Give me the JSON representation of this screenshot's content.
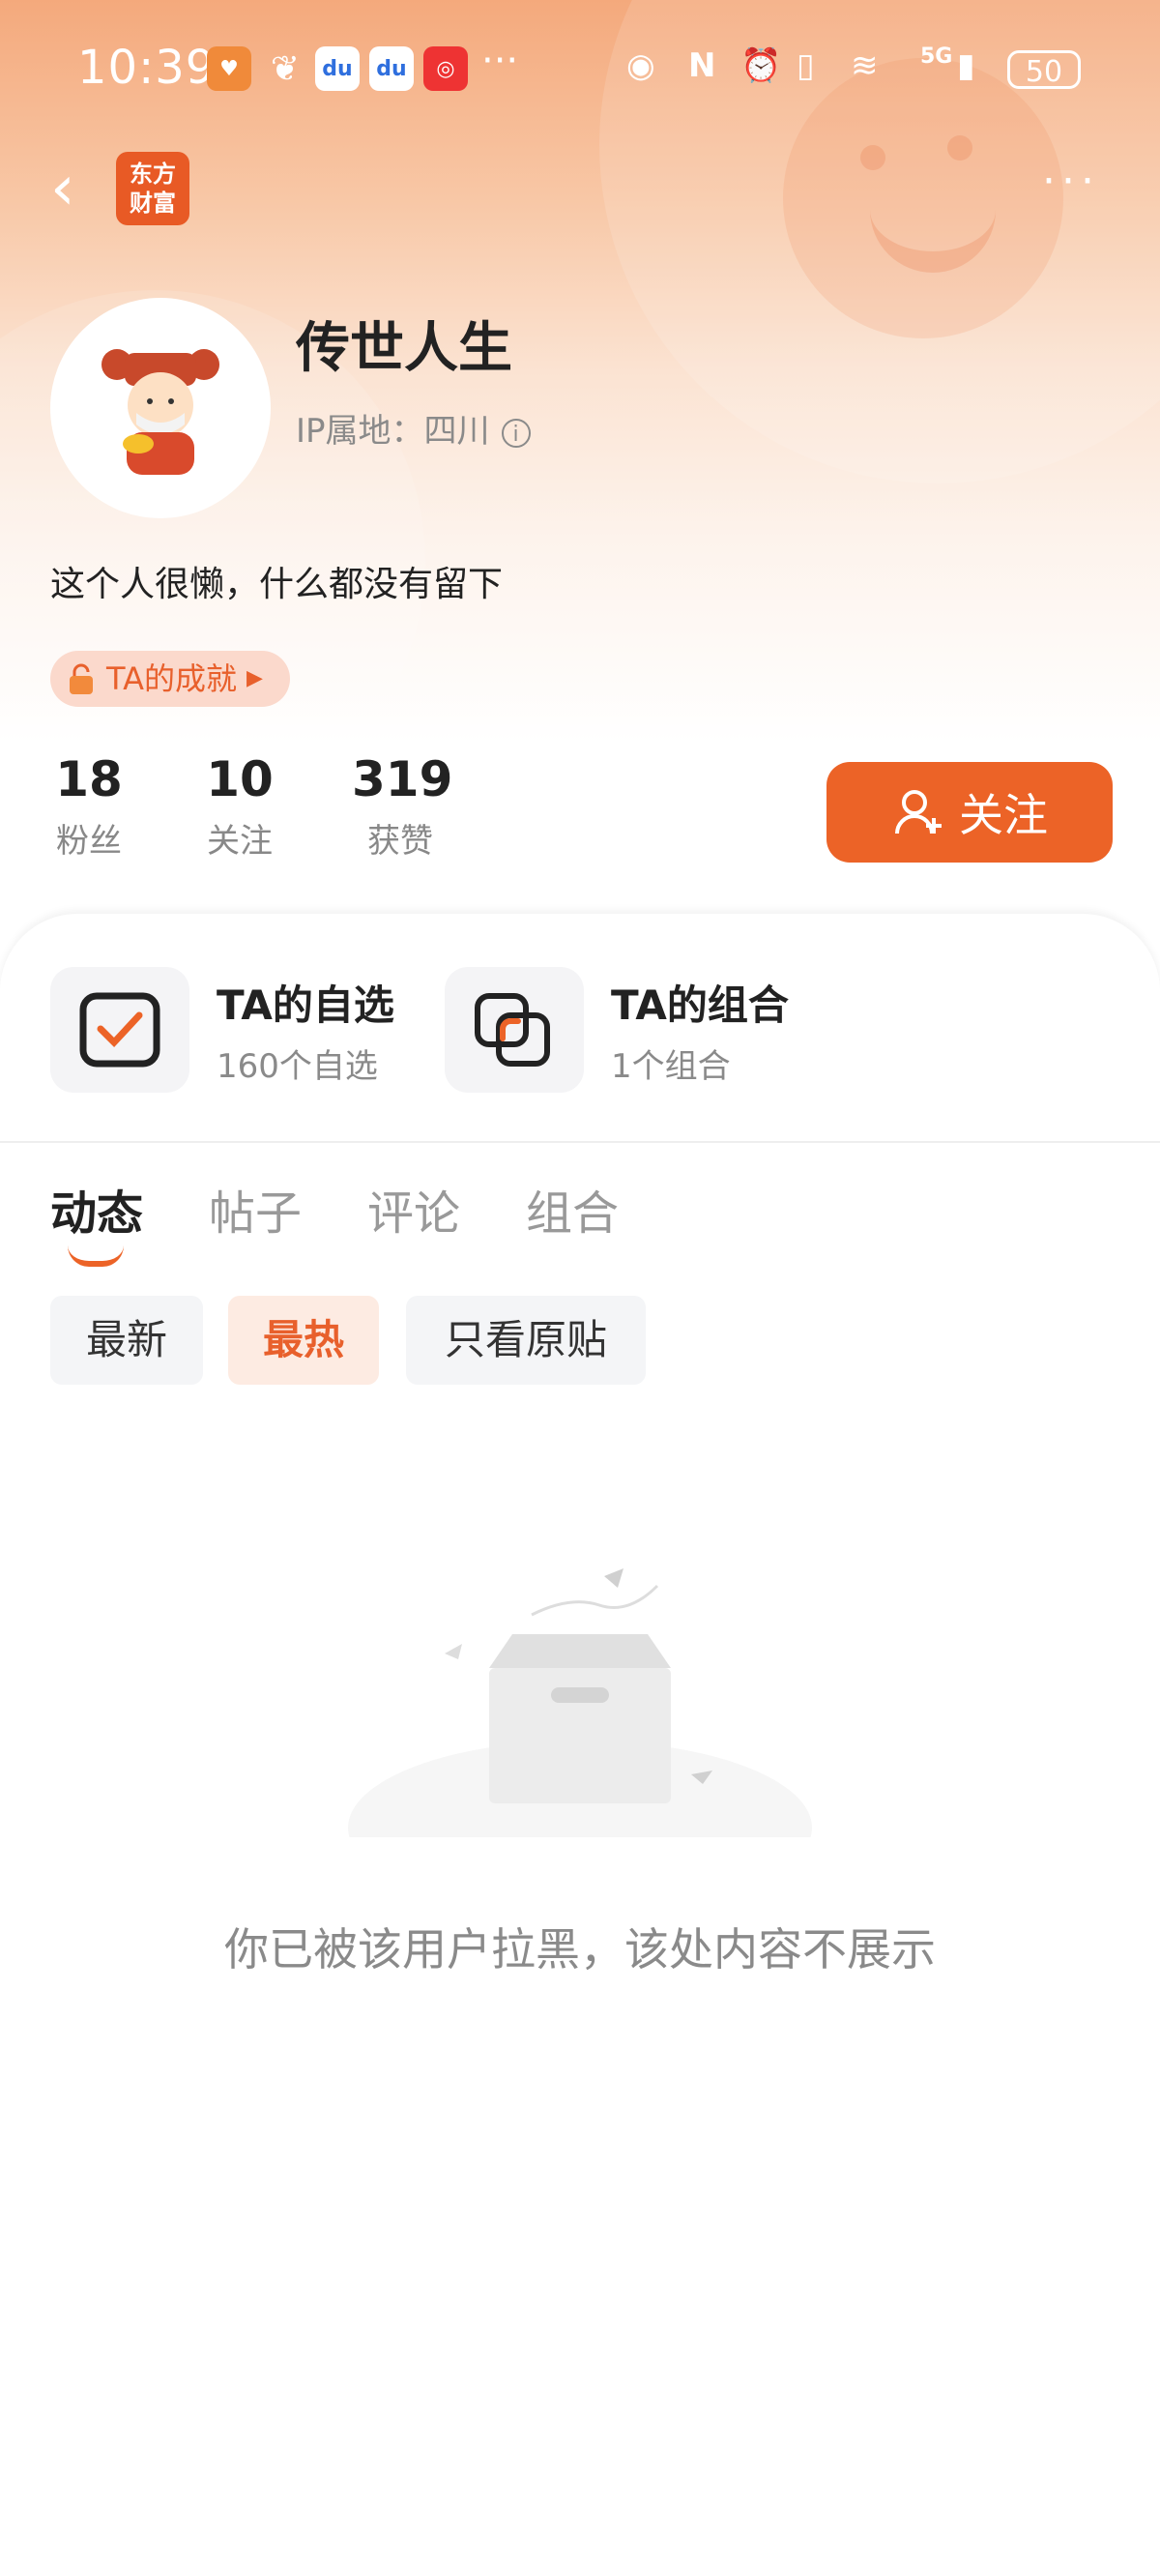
{
  "status_bar": {
    "time": "10:39",
    "battery": "50",
    "more": "···",
    "net": "5G"
  },
  "header": {
    "logo_text": "东方\n财富"
  },
  "profile": {
    "name": "传世人生",
    "ip": "IP属地：四川",
    "bio": "这个人很懒，什么都没有留下",
    "achievement": "TA的成就"
  },
  "stats": [
    {
      "value": "18",
      "label": "粉丝"
    },
    {
      "value": "10",
      "label": "关注"
    },
    {
      "value": "319",
      "label": "获赞"
    }
  ],
  "follow_label": "关注",
  "features": [
    {
      "title": "TA的自选",
      "sub": "160个自选",
      "icon": "watchlist-icon"
    },
    {
      "title": "TA的组合",
      "sub": "1个组合",
      "icon": "portfolio-icon"
    }
  ],
  "tabs": [
    "动态",
    "帖子",
    "评论",
    "组合"
  ],
  "filters": [
    "最新",
    "最热",
    "只看原贴"
  ],
  "empty_message": "你已被该用户拉黑，该处内容不展示",
  "colors": {
    "accent": "#ec6327",
    "hero_top": "#f4a97c"
  }
}
